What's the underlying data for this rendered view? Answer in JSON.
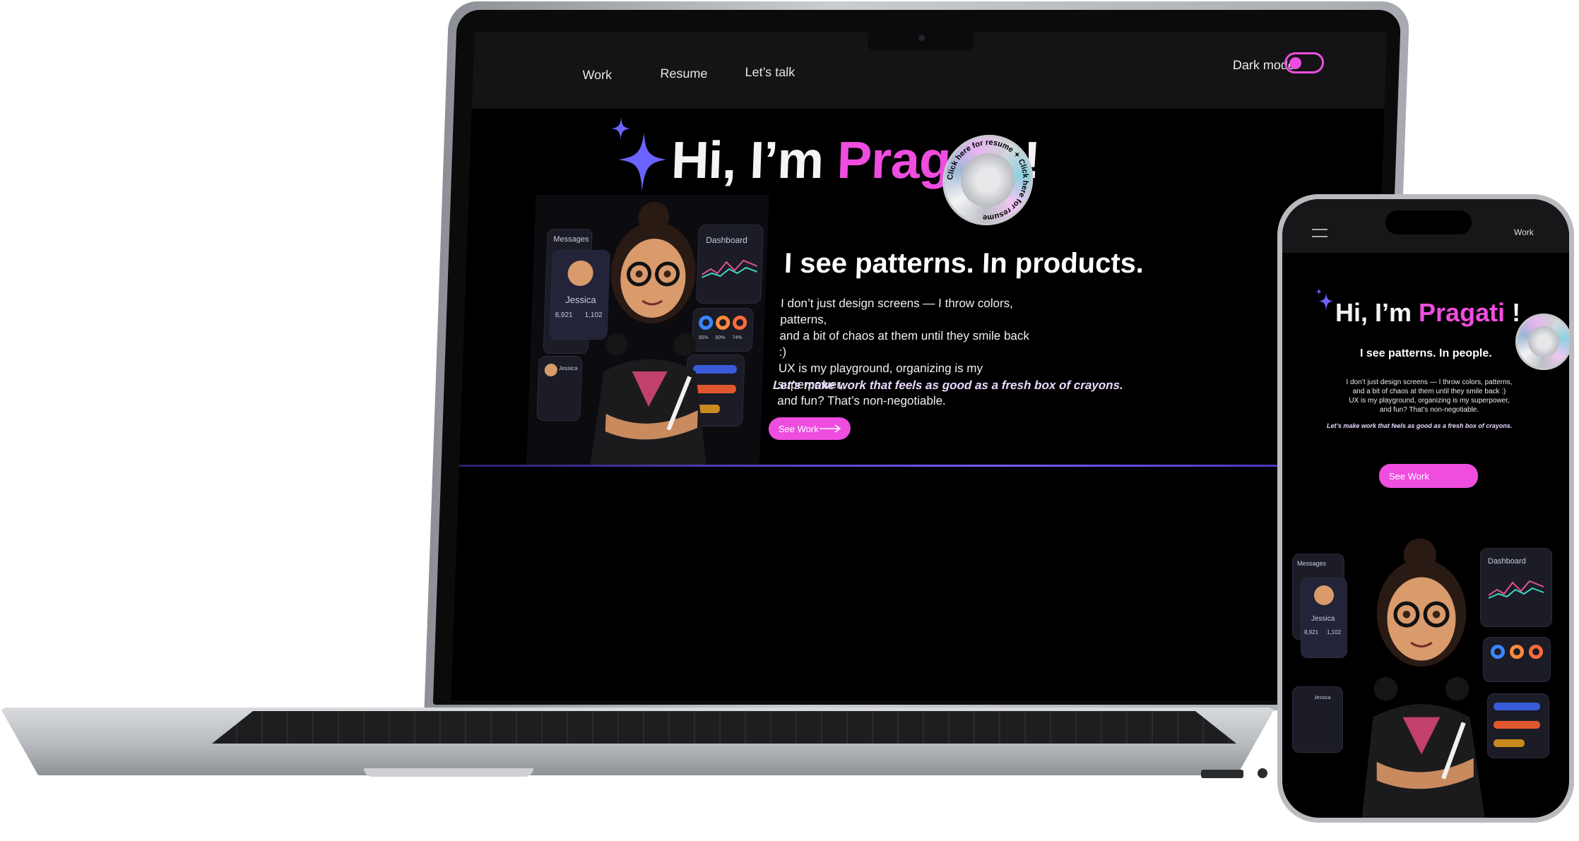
{
  "nav": {
    "work": "Work",
    "resume": "Resume",
    "talk": "Let’s talk",
    "dark_mode_label": "Dark mode",
    "dark_mode_on": true
  },
  "hero": {
    "greeting": "Hi, I’m ",
    "name": "Pragati",
    "exclaim": "!",
    "badge_text": "Click here for resume ✦ Click here for resume",
    "tagline": "I see patterns. In products.",
    "para_lines": [
      "I don’t just design screens — I throw colors, patterns,",
      "and a bit of chaos at them until they smile back :)",
      "UX is my playground, organizing is my superpower,",
      "and fun? That’s non-negotiable."
    ],
    "italic": "Let’s make work that feels as good as a fresh box of crayons.",
    "cta": "See Work"
  },
  "illustration": {
    "messages_title": "Messages",
    "profile_name": "Jessica",
    "stat1": "8,921",
    "stat2": "1,102",
    "contact_name": "Jessica",
    "dashboard_title": "Dashboard",
    "rings": [
      "35%",
      "50%",
      "74%"
    ]
  },
  "phone": {
    "nav_work": "Work",
    "greeting": "Hi, I’m ",
    "name": "Pragati",
    "exclaim": "!",
    "tagline": "I see patterns. In people.",
    "para_lines": [
      "I don’t just design screens — I throw colors, patterns,",
      "and a bit of chaos at them until they smile back :)",
      "UX is my playground, organizing is my superpower,",
      "and fun? That’s non-negotiable."
    ],
    "italic": "Let’s make work that feels as good as a fresh box of crayons.",
    "cta": "See Work"
  },
  "colors": {
    "accent_pink": "#ee4ddf",
    "sparkle": "#6b63ff",
    "background": "#000000"
  },
  "icons": [
    "sparkle-icon",
    "arrow-right-icon",
    "hamburger-icon",
    "camera-icon"
  ]
}
